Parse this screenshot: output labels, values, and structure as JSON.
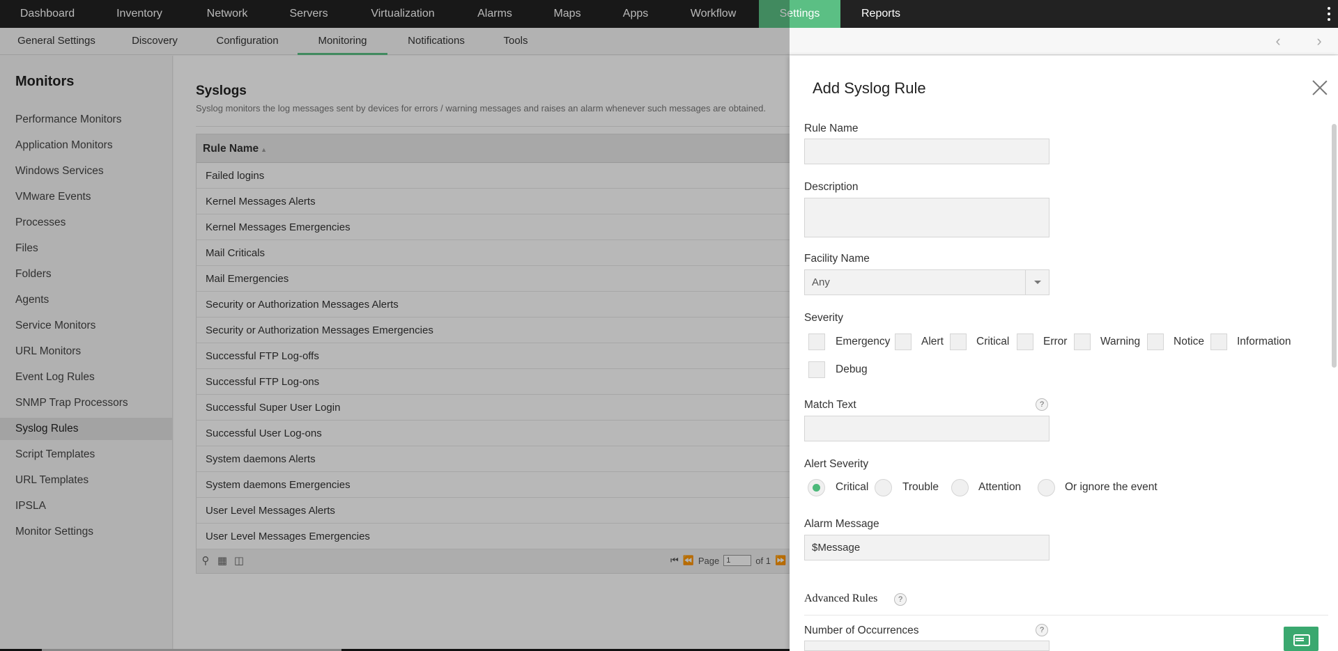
{
  "topnav": {
    "items": [
      {
        "label": "Dashboard",
        "active": false
      },
      {
        "label": "Inventory",
        "active": false
      },
      {
        "label": "Network",
        "active": false
      },
      {
        "label": "Servers",
        "active": false
      },
      {
        "label": "Virtualization",
        "active": false
      },
      {
        "label": "Alarms",
        "active": false
      },
      {
        "label": "Maps",
        "active": false
      },
      {
        "label": "Apps",
        "active": false
      },
      {
        "label": "Workflow",
        "active": false
      },
      {
        "label": "Settings",
        "active": true
      },
      {
        "label": "Reports",
        "active": false
      }
    ],
    "accent": "#5bbf84"
  },
  "subnav": {
    "items": [
      {
        "label": "General Settings"
      },
      {
        "label": "Discovery"
      },
      {
        "label": "Configuration"
      },
      {
        "label": "Monitoring"
      },
      {
        "label": "Notifications"
      },
      {
        "label": "Tools"
      }
    ],
    "active": "Monitoring"
  },
  "sidebar": {
    "title": "Monitors",
    "items": [
      "Performance Monitors",
      "Application Monitors",
      "Windows Services",
      "VMware Events",
      "Processes",
      "Files",
      "Folders",
      "Agents",
      "Service Monitors",
      "URL Monitors",
      "Event Log Rules",
      "SNMP Trap Processors",
      "Syslog Rules",
      "Script Templates",
      "URL Templates",
      "IPSLA",
      "Monitor Settings"
    ],
    "active": "Syslog Rules"
  },
  "main": {
    "title": "Syslogs",
    "description": "Syslog monitors the log messages sent by devices for errors / warning messages and raises an alarm whenever such messages are obtained.",
    "table": {
      "column": "Rule Name",
      "rows": [
        "Failed logins",
        "Kernel Messages Alerts",
        "Kernel Messages Emergencies",
        "Mail Criticals",
        "Mail Emergencies",
        "Security or Authorization Messages Alerts",
        "Security or Authorization Messages Emergencies",
        "Successful FTP Log-offs",
        "Successful FTP Log-ons",
        "Successful Super User Login",
        "Successful User Log-ons",
        "System daemons Alerts",
        "System daemons Emergencies",
        "User Level Messages Alerts",
        "User Level Messages Emergencies"
      ],
      "pager": {
        "page_label": "Page",
        "page_value": "1",
        "of_label": "of 1"
      }
    }
  },
  "panel": {
    "title": "Add Syslog Rule",
    "rule_name": {
      "label": "Rule Name",
      "value": ""
    },
    "description": {
      "label": "Description",
      "value": ""
    },
    "facility": {
      "label": "Facility Name",
      "value": "Any"
    },
    "severity": {
      "label": "Severity",
      "options": [
        "Emergency",
        "Alert",
        "Critical",
        "Error",
        "Warning",
        "Notice",
        "Information",
        "Debug"
      ]
    },
    "match_text": {
      "label": "Match Text",
      "value": "",
      "help": "?"
    },
    "alert_severity": {
      "label": "Alert Severity",
      "options": [
        "Critical",
        "Trouble",
        "Attention",
        "Or ignore the event"
      ],
      "selected": "Critical"
    },
    "alarm_message": {
      "label": "Alarm Message",
      "value": "$Message"
    },
    "advanced": {
      "label": "Advanced Rules",
      "help": "?"
    },
    "occurrences": {
      "label": "Number of Occurrences",
      "help": "?"
    }
  }
}
